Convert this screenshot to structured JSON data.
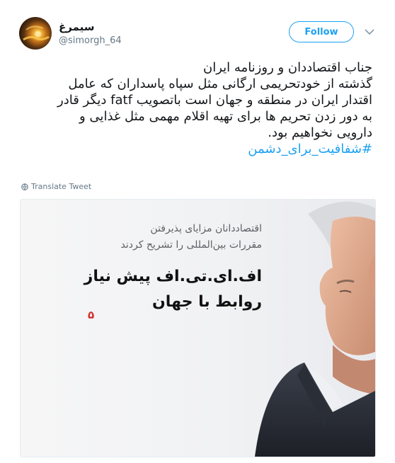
{
  "author": {
    "display_name": "سیمرغ",
    "handle": "@simorgh_64"
  },
  "follow_label": "Follow",
  "tweet": {
    "lines": [
      "جناب اقتصاددان و روزنامه ایران",
      "گذشته از خودتحریمی ارگانی مثل سپاه پاسداران که عامل",
      "اقتدار ایران در منطقه و جهان است باتصویب fatf دیگر قادر",
      "به دور زدن تحریم ها برای تهیه اقلام مهمی مثل غذایی و",
      "دارویی نخواهیم بود."
    ],
    "hashtag": "#شفافیت_برای_دشمن"
  },
  "translate_label": "Translate Tweet",
  "media": {
    "subtitle_line1": "اقتصاددانان مزایای پذیرفتن",
    "subtitle_line2": "مقررات بین‌المللی را تشریح کردند",
    "headline_line1": "اف.ای.تی.اف پیش نیاز",
    "headline_line2": "روابط با جهان",
    "page_number": "۵"
  }
}
